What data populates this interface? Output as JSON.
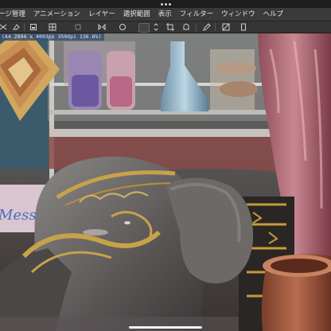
{
  "window": {
    "more_dots": "more-horizontal-icon"
  },
  "menu": {
    "items": [
      "ージ管理",
      "アニメーション",
      "レイヤー",
      "選択範囲",
      "表示",
      "フィルター",
      "ウィンドウ",
      "ヘルプ"
    ]
  },
  "toolbar": {
    "icons": [
      "scissors-icon",
      "eraser-icon",
      "fill-icon",
      "grid-icon",
      "transform-icon",
      "flip-icon",
      "circle-select-icon",
      "layer-dropdown",
      "crop-icon",
      "lasso-icon",
      "pen-icon",
      "mask-icon",
      "device-icon"
    ]
  },
  "canvas": {
    "info_text": "(A4 2894 x 4093px 350dpi 136.6%)",
    "artwork": {
      "sign_text": "Mess"
    }
  },
  "colors": {
    "menubar_bg": "#3a3a3a",
    "toolbar_bg": "#353535",
    "info_bg": "#3c506e"
  }
}
